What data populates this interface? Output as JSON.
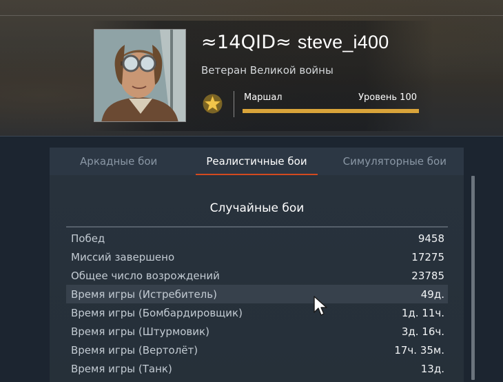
{
  "player": {
    "clan_tag": "≈14QID≈",
    "nickname": "steve_i400",
    "title": "Ветеран Великой войны",
    "rank_name": "Маршал",
    "level_label": "Уровень 100",
    "xp_progress_percent": 100
  },
  "tabs": [
    {
      "label": "Аркадные бои",
      "active": false
    },
    {
      "label": "Реалистичные бои",
      "active": true
    },
    {
      "label": "Симуляторные бои",
      "active": false
    }
  ],
  "section": {
    "title": "Случайные бои",
    "rows": [
      {
        "label": "Побед",
        "value": "9458"
      },
      {
        "label": "Миссий завершено",
        "value": "17275"
      },
      {
        "label": "Общее число возрождений",
        "value": "23785"
      },
      {
        "label": "Время игры (Истребитель)",
        "value": "49д."
      },
      {
        "label": "Время игры (Бомбардировщик)",
        "value": "1д. 11ч."
      },
      {
        "label": "Время игры (Штурмовик)",
        "value": "3д. 16ч."
      },
      {
        "label": "Время игры (Вертолёт)",
        "value": "17ч. 35м."
      },
      {
        "label": "Время игры (Танк)",
        "value": "13д."
      }
    ]
  },
  "colors": {
    "accent_tab": "#d34a1f",
    "xp_bar": "#d9a43a",
    "background": "#1c2530"
  }
}
